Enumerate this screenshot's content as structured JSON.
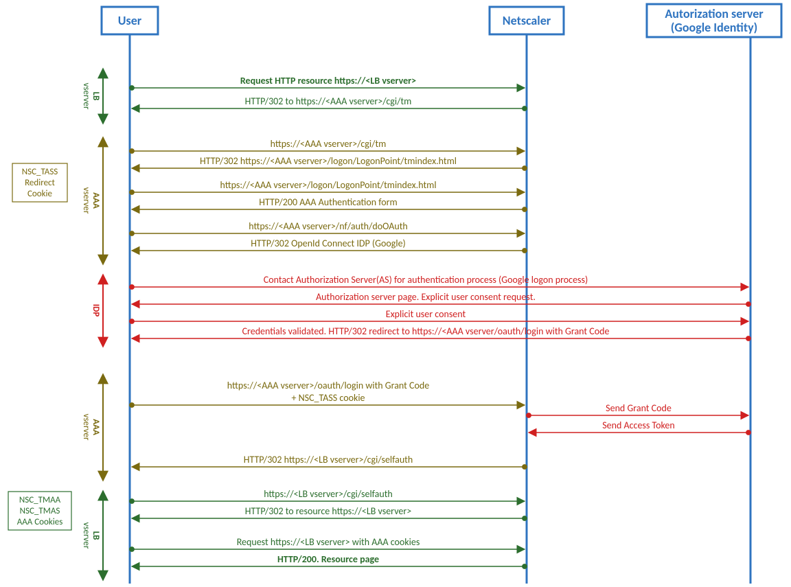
{
  "actors": {
    "user": "User",
    "netscaler": "Netscaler",
    "authserver_l1": "Autorization server",
    "authserver_l2": "(Google Identity)"
  },
  "notes": {
    "nsc_tass": [
      "NSC_TASS",
      "Redirect",
      "Cookie"
    ],
    "nsc_tmaa": [
      "NSC_TMAA",
      "NSC_TMAS",
      "AAA Cookies"
    ]
  },
  "phases": {
    "lb1": "LB",
    "lb1_sub": "vserver",
    "aaa1": "AAA",
    "aaa1_sub": "vserver",
    "idp": "IDP",
    "aaa2": "AAA",
    "aaa2_sub": "vserver",
    "lb2": "LB",
    "lb2_sub": "vserver"
  },
  "messages": {
    "m1": "Request HTTP resource https://<LB vserver>",
    "m2": "HTTP/302 to https://<AAA vserver>/cgi/tm",
    "m3": "https://<AAA vserver>/cgi/tm",
    "m4": "HTTP/302 https://<AAA vserver>/logon/LogonPoint/tmindex.html",
    "m5": "https://<AAA vserver>/logon/LogonPoint/tmindex.html",
    "m6": "HTTP/200 AAA Authentication form",
    "m7": "https://<AAA vserver>/nf/auth/doOAuth",
    "m8": "HTTP/302 OpenId Connect IDP (Google)",
    "m9": "Contact Authorization Server(AS)  for authentication process (Google logon process)",
    "m10": "Authorization server page. Explicit user consent request.",
    "m11": "Explicit user consent",
    "m12": "Credentials validated. HTTP/302 redirect to https://<AAA vserver/oauth/login with Grant Code",
    "m13a": "https://<AAA vserver>/oauth/login with Grant Code",
    "m13b": "+ NSC_TASS cookie",
    "m14": "Send Grant Code",
    "m15": "Send Access Token",
    "m16": "HTTP/302 https://<LB vserver>/cgi/selfauth",
    "m17": "https://<LB vserver>/cgi/selfauth",
    "m18": "HTTP/302 to resource https://<LB vserver>",
    "m19": "Request https://<LB vserver> with AAA cookies",
    "m20": "HTTP/200. Resource page"
  },
  "colors": {
    "green": "#2c6e2e",
    "olive": "#7a6a10",
    "red": "#d02020",
    "blue": "#2f74c0"
  }
}
